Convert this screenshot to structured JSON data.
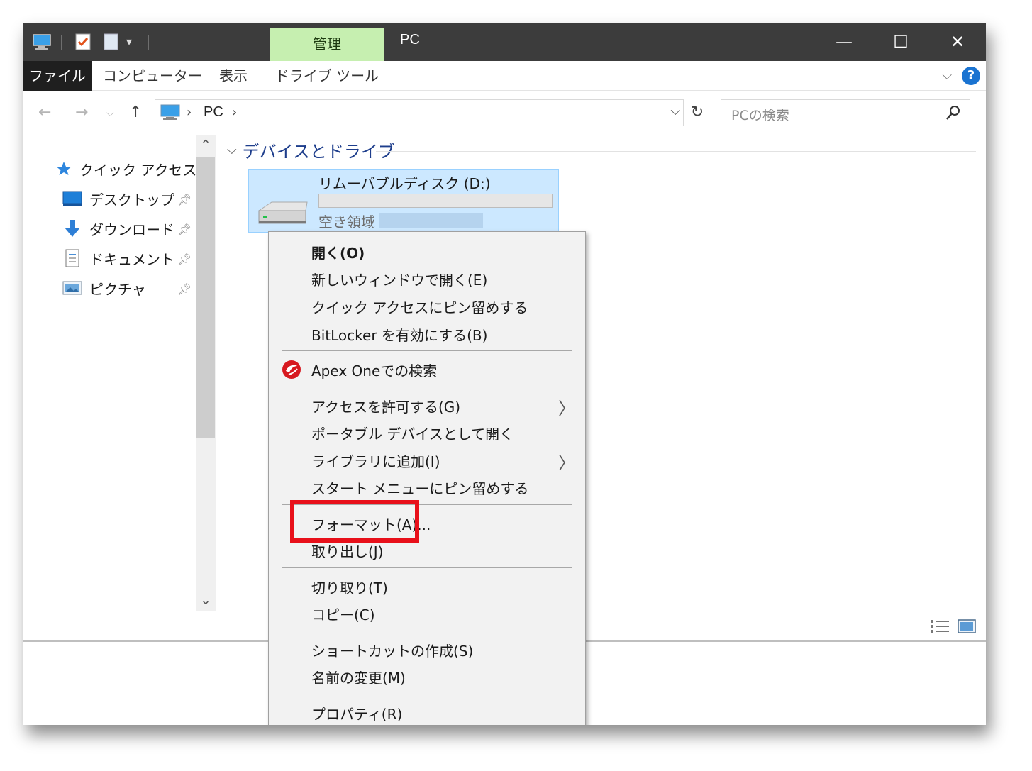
{
  "window": {
    "title": "PC",
    "context_tab_title": "管理",
    "controls": {
      "minimize": "—",
      "maximize": "☐",
      "close": "✕"
    }
  },
  "ribbon": {
    "tabs": [
      "ファイル",
      "コンピューター",
      "表示",
      "ドライブ ツール"
    ],
    "collapse_glyph": "⌵",
    "help_glyph": "?"
  },
  "address_bar": {
    "path": "PC",
    "search_placeholder": "PCの検索"
  },
  "navigation_pane": {
    "items": [
      {
        "label": "クイック アクセス",
        "icon": "quick-access-star-icon",
        "pinned": false
      },
      {
        "label": "デスクトップ",
        "icon": "desktop-icon",
        "pinned": true
      },
      {
        "label": "ダウンロード",
        "icon": "download-icon",
        "pinned": true
      },
      {
        "label": "ドキュメント",
        "icon": "document-icon",
        "pinned": true
      },
      {
        "label": "ピクチャ",
        "icon": "pictures-icon",
        "pinned": true
      }
    ]
  },
  "content": {
    "group_title": "デバイスとドライブ",
    "drive": {
      "name": "リムーバブルディスク (D:)",
      "free_label": "空き領域",
      "icon": "removable-disk-icon"
    }
  },
  "context_menu": {
    "items": [
      {
        "label": "開く(O)",
        "bold": true
      },
      {
        "label": "新しいウィンドウで開く(E)"
      },
      {
        "label": "クイック アクセスにピン留めする"
      },
      {
        "label": "BitLocker を有効にする(B)"
      },
      {
        "label": "Apex Oneでの検索",
        "icon": "apex-one-icon"
      },
      {
        "label": "アクセスを許可する(G)",
        "submenu": true
      },
      {
        "label": "ポータブル デバイスとして開く"
      },
      {
        "label": "ライブラリに追加(I)",
        "submenu": true
      },
      {
        "label": "スタート メニューにピン留めする"
      },
      {
        "label": "フォーマット(A)...",
        "highlighted": true
      },
      {
        "label": "取り出し(J)"
      },
      {
        "label": "切り取り(T)"
      },
      {
        "label": "コピー(C)"
      },
      {
        "label": "ショートカットの作成(S)"
      },
      {
        "label": "名前の変更(M)"
      },
      {
        "label": "プロパティ(R)"
      }
    ],
    "submenu_glyph": "〉",
    "highlight_color": "#e8101a"
  },
  "colors": {
    "titlebar": "#3c3c3c",
    "context_tab": "#c6efb0",
    "selection": "#cce8ff",
    "accent": "#1a73d1"
  }
}
